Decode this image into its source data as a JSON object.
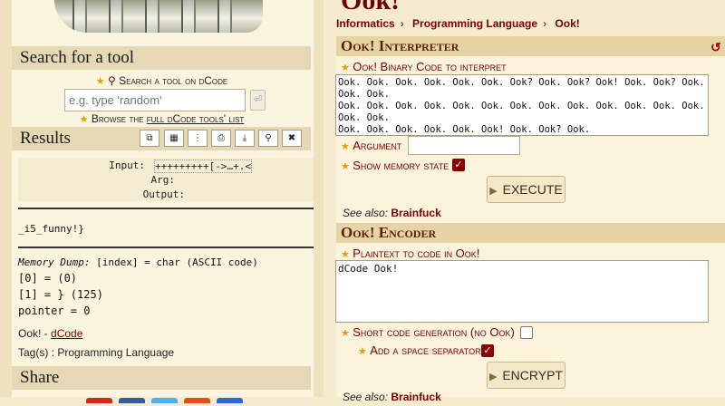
{
  "sidebar": {
    "search_heading": "Search for a tool",
    "search_link": "Search a tool on dCode",
    "search_placeholder": "e.g. type 'random'",
    "search_button": "⏎",
    "browse_prefix": "Browse the ",
    "browse_link": "full dCode tools' list",
    "results_heading": "Results",
    "result_buttons": [
      "⧉",
      "▦",
      "⋮",
      "⎙",
      "⤓",
      "⚲",
      "✖"
    ],
    "input_label": "Input:",
    "input_value": "+++++++++[->…+.<",
    "arg_label": "Arg:",
    "output_label": "Output:",
    "result_text": "_i5_funny!}",
    "memory_title": "Memory Dump:",
    "memory_desc": "[index] = char (ASCII code)",
    "memory_line1": "[0] =   (0)",
    "memory_line2": "[1] = }  (125)",
    "pointer": "pointer = 0",
    "source_prefix": "Ook! - ",
    "source_link": "dCode",
    "tags": "Tag(s) : Programming Language",
    "share_heading": "Share",
    "share_colors": [
      "#cc2b1f",
      "#3b5b99",
      "#55acee",
      "#e0501d",
      "#2a6bd1"
    ]
  },
  "page": {
    "title": "Ook!",
    "breadcrumbs": [
      "Informatics",
      "Programming Language",
      "Ook!"
    ]
  },
  "interpreter": {
    "heading": "Ook! Interpreter",
    "code_label": "Ook! Binary Code to interpret",
    "code_value": "Ook. Ook. Ook. Ook. Ook. Ook. Ook? Ook. Ook? Ook! Ook. Ook? Ook. Ook. Ook.\nOok. Ook. Ook. Ook. Ook. Ook. Ook. Ook. Ook. Ook. Ook. Ook. Ook. Ook. Ook.\nOok. Ook. Ook. Ook. Ook. Ook! Ook. Ook? Ook.",
    "argument_label": "Argument",
    "memory_label": "Show memory state",
    "execute_label": "EXECUTE",
    "see_also_label": "See also:",
    "see_also_link": "Brainfuck"
  },
  "encoder": {
    "heading": "Ook! Encoder",
    "plaintext_label": "Plaintext to code in Ook!",
    "plaintext_value": "dCode Ook!",
    "short_label": "Short code generation (no Ook)",
    "space_label": "Add a space separator",
    "encrypt_label": "ENCRYPT",
    "see_also_label": "See also:",
    "see_also_link": "Brainfuck"
  }
}
